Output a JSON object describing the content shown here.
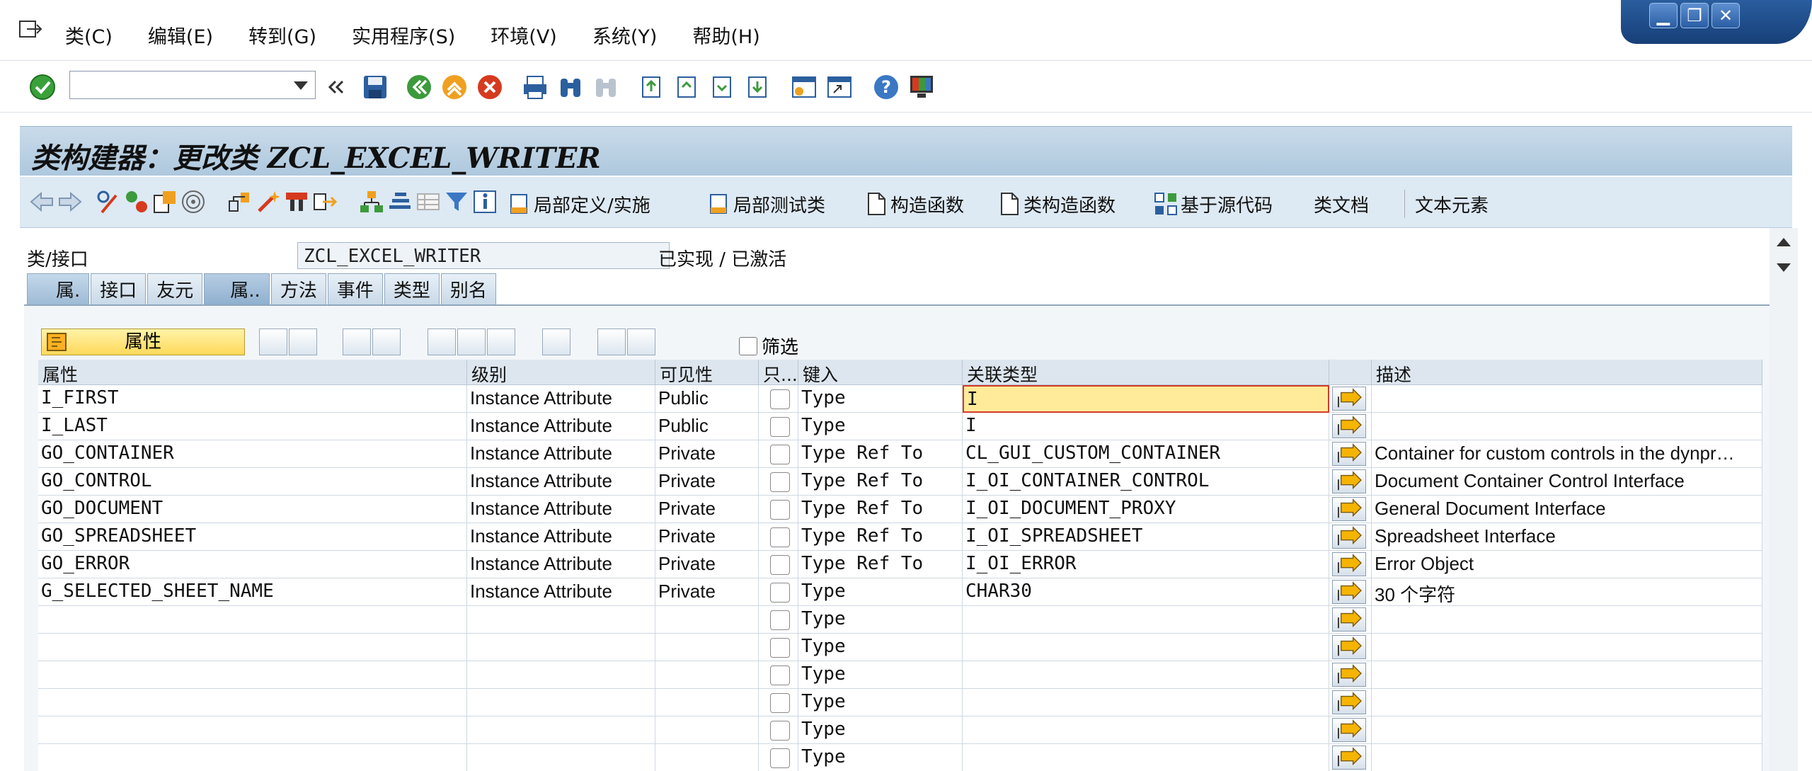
{
  "menu": {
    "items": [
      "类(C)",
      "编辑(E)",
      "转到(G)",
      "实用程序(S)",
      "环境(V)",
      "系统(Y)",
      "帮助(H)"
    ]
  },
  "window_controls": {
    "minimize": "▁",
    "restore": "❐",
    "close": "✕"
  },
  "title": "类构建器：更改类 ZCL_EXCEL_WRITER",
  "app_toolbar": {
    "local_defs": "局部定义/实施",
    "local_test": "局部测试类",
    "constructor": "构造函数",
    "class_constructor": "类构造函数",
    "source_based": "基于源代码",
    "class_doc": "类文档",
    "text_elements": "文本元素"
  },
  "header": {
    "class_label": "类/接口",
    "class_value": "ZCL_EXCEL_WRITER",
    "status": "已实现 / 已激活"
  },
  "tabs": [
    "属.",
    "接口",
    "友元",
    "属..",
    "方法",
    "事件",
    "类型",
    "别名"
  ],
  "grid_toolbar": {
    "attr_button": "属性",
    "filter_label": "筛选"
  },
  "table": {
    "columns": [
      "属性",
      "级别",
      "可见性",
      "只...",
      "键入",
      "关联类型",
      "",
      "描述"
    ],
    "rows": [
      {
        "attr": "I_FIRST",
        "level": "Instance Attribute",
        "vis": "Public",
        "typing": "Type",
        "assoc": "I",
        "desc": ""
      },
      {
        "attr": "I_LAST",
        "level": "Instance Attribute",
        "vis": "Public",
        "typing": "Type",
        "assoc": "I",
        "desc": ""
      },
      {
        "attr": "GO_CONTAINER",
        "level": "Instance Attribute",
        "vis": "Private",
        "typing": "Type Ref To",
        "assoc": "CL_GUI_CUSTOM_CONTAINER",
        "desc": "Container for custom controls in the dynpr…"
      },
      {
        "attr": "GO_CONTROL",
        "level": "Instance Attribute",
        "vis": "Private",
        "typing": "Type Ref To",
        "assoc": "I_OI_CONTAINER_CONTROL",
        "desc": "Document Container Control Interface"
      },
      {
        "attr": "GO_DOCUMENT",
        "level": "Instance Attribute",
        "vis": "Private",
        "typing": "Type Ref To",
        "assoc": "I_OI_DOCUMENT_PROXY",
        "desc": "General Document Interface"
      },
      {
        "attr": "GO_SPREADSHEET",
        "level": "Instance Attribute",
        "vis": "Private",
        "typing": "Type Ref To",
        "assoc": "I_OI_SPREADSHEET",
        "desc": "Spreadsheet Interface"
      },
      {
        "attr": "GO_ERROR",
        "level": "Instance Attribute",
        "vis": "Private",
        "typing": "Type Ref To",
        "assoc": "I_OI_ERROR",
        "desc": "Error Object"
      },
      {
        "attr": "G_SELECTED_SHEET_NAME",
        "level": "Instance Attribute",
        "vis": "Private",
        "typing": "Type",
        "assoc": "CHAR30",
        "desc": "30 个字符"
      },
      {
        "attr": "",
        "level": "",
        "vis": "",
        "typing": "Type",
        "assoc": "",
        "desc": ""
      },
      {
        "attr": "",
        "level": "",
        "vis": "",
        "typing": "Type",
        "assoc": "",
        "desc": ""
      },
      {
        "attr": "",
        "level": "",
        "vis": "",
        "typing": "Type",
        "assoc": "",
        "desc": ""
      },
      {
        "attr": "",
        "level": "",
        "vis": "",
        "typing": "Type",
        "assoc": "",
        "desc": ""
      },
      {
        "attr": "",
        "level": "",
        "vis": "",
        "typing": "Type",
        "assoc": "",
        "desc": ""
      },
      {
        "attr": "",
        "level": "",
        "vis": "",
        "typing": "Type",
        "assoc": "",
        "desc": ""
      }
    ]
  },
  "colors": {
    "title_bg": "#aec8de",
    "app_bar_bg": "#dde9f3",
    "highlight": "#ffeb99",
    "error_border": "#d43a2a"
  }
}
